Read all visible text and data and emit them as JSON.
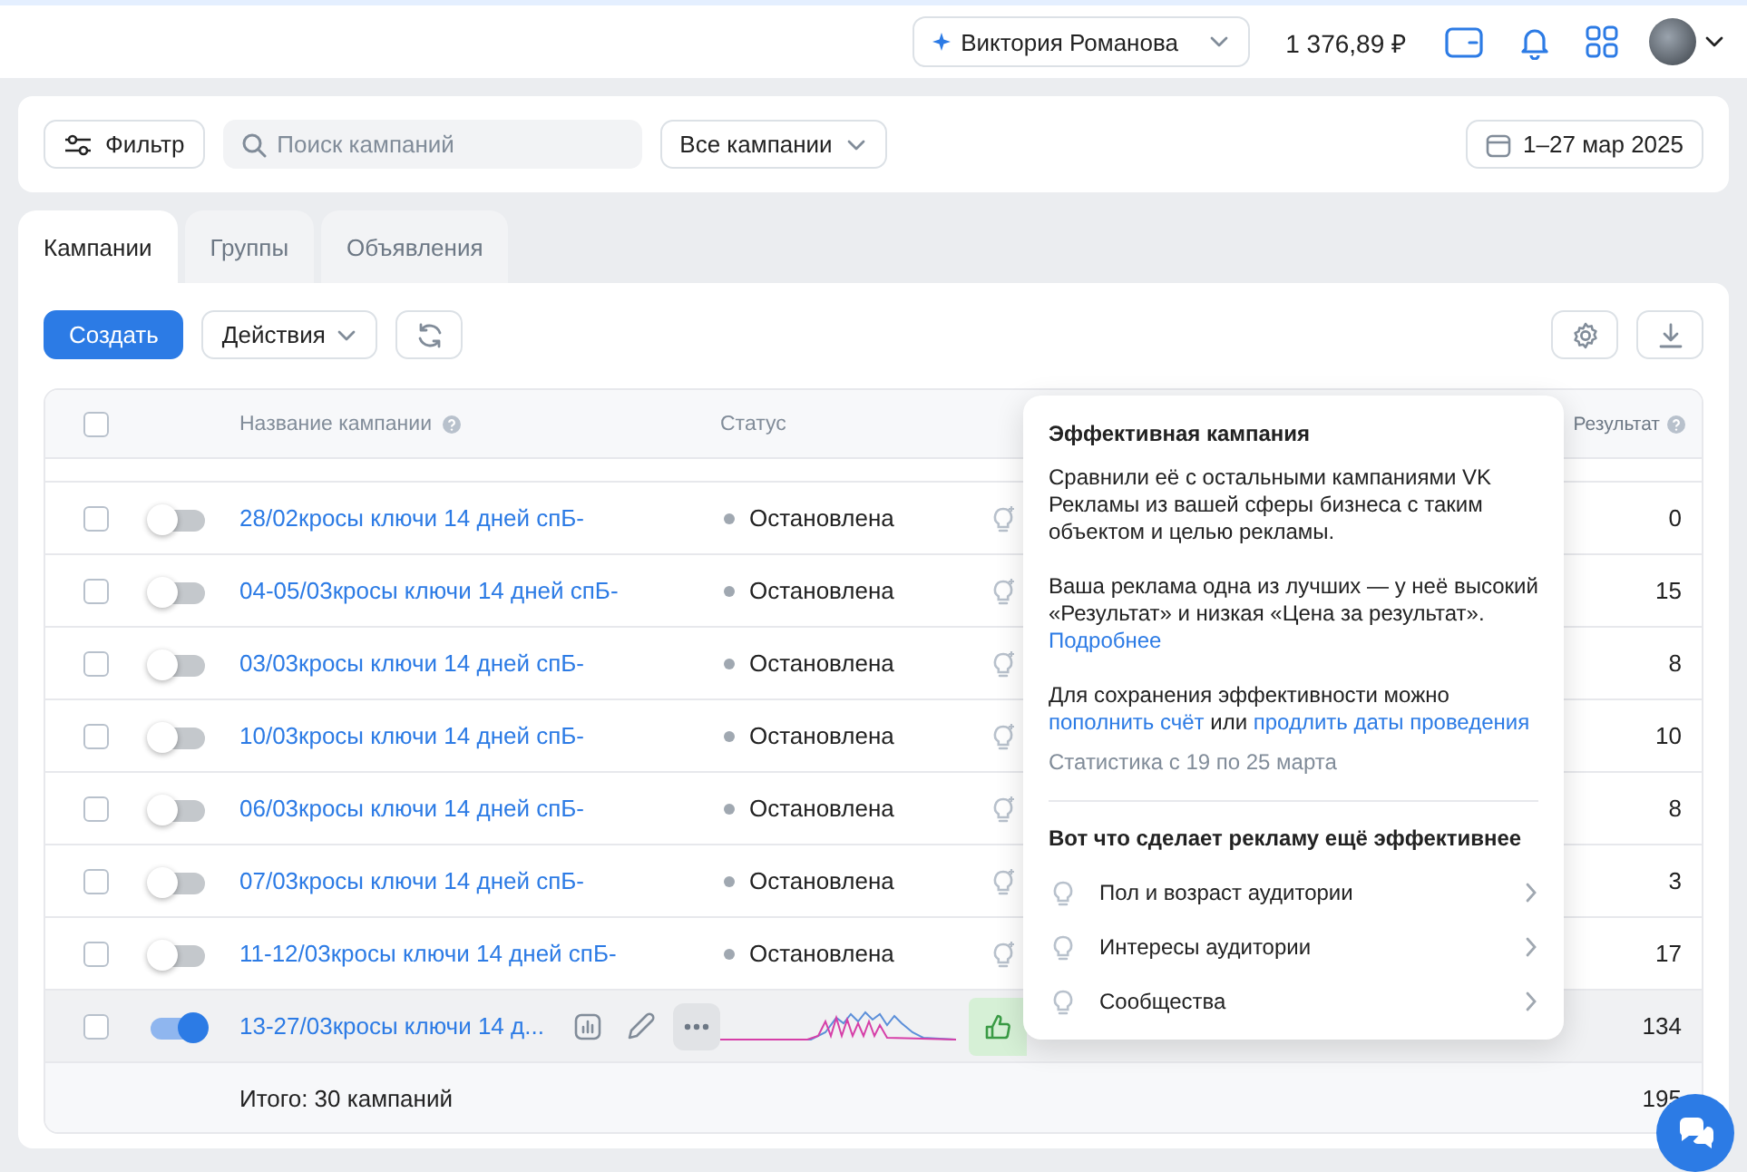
{
  "topbar": {
    "account": "Виктория Романова",
    "balance": "1 376,89 ₽"
  },
  "filters": {
    "filter_button": "Фильтр",
    "search": {
      "placeholder": "Поиск кампаний"
    },
    "campaign_select": "Все кампании",
    "date_range": "1–27 мар 2025"
  },
  "tabs": [
    {
      "label": "Кампании",
      "selected": true
    },
    {
      "label": "Группы",
      "selected": false
    },
    {
      "label": "Объявления",
      "selected": false
    }
  ],
  "toolbar": {
    "create_button": "Создать",
    "actions_menu": "Действия"
  },
  "table": {
    "columns": [
      "Название кампании",
      "Статус",
      "Результат"
    ],
    "select_all_checked": false,
    "rows": [
      {
        "name": "28/02кросы ключи 14 дней спБ-",
        "checked": false,
        "enabled": false,
        "hovered": false,
        "status": "Остановлена",
        "result": "0"
      },
      {
        "name": "04-05/03кросы ключи 14 дней спБ-",
        "checked": false,
        "enabled": false,
        "hovered": false,
        "status": "Остановлена",
        "result": "15"
      },
      {
        "name": "03/03кросы ключи 14 дней спБ-",
        "checked": false,
        "enabled": false,
        "hovered": false,
        "status": "Остановлена",
        "result": "8"
      },
      {
        "name": "10/03кросы ключи 14 дней спБ-",
        "checked": false,
        "enabled": false,
        "hovered": false,
        "status": "Остановлена",
        "result": "10"
      },
      {
        "name": "06/03кросы ключи 14 дней спБ-",
        "checked": false,
        "enabled": false,
        "hovered": false,
        "status": "Остановлена",
        "result": "8"
      },
      {
        "name": "07/03кросы ключи 14 дней спБ-",
        "checked": false,
        "enabled": false,
        "hovered": false,
        "status": "Остановлена",
        "result": "3"
      },
      {
        "name": "11-12/03кросы ключи 14 дней спБ-",
        "checked": false,
        "enabled": false,
        "hovered": false,
        "status": "Остановлена",
        "result": "17"
      },
      {
        "name": "13-27/03кросы ключи 14 д...",
        "checked": false,
        "enabled": true,
        "hovered": true,
        "result": "134"
      }
    ],
    "footer": {
      "total": "Итого: 30 кампаний",
      "result": "195"
    }
  },
  "tooltip": {
    "title": "Эффективная кампания",
    "paragraphs": [
      [
        {
          "kind": "text",
          "text": "Сравнили её с остальными кампаниями VK Рекламы из вашей сферы бизнеса с таким объектом и целью рекламы."
        }
      ],
      [
        {
          "kind": "text",
          "text": "Ваша реклама одна из лучших — у неё высокий «Результат» и низкая «Цена за результат». "
        },
        {
          "kind": "link",
          "text": "Подробнее"
        }
      ],
      [
        {
          "kind": "text",
          "text": "Для сохранения эффективности можно "
        },
        {
          "kind": "link",
          "text": "пополнить счёт"
        },
        {
          "kind": "text",
          "text": " или "
        },
        {
          "kind": "link",
          "text": "продлить даты проведения"
        }
      ]
    ],
    "note": "Статистика с 19 по 25 марта",
    "heading": "Вот что сделает рекламу ещё эффективнее",
    "suggestions": [
      "Пол и возраст аудитории",
      "Интересы аудитории",
      "Сообщества"
    ]
  }
}
